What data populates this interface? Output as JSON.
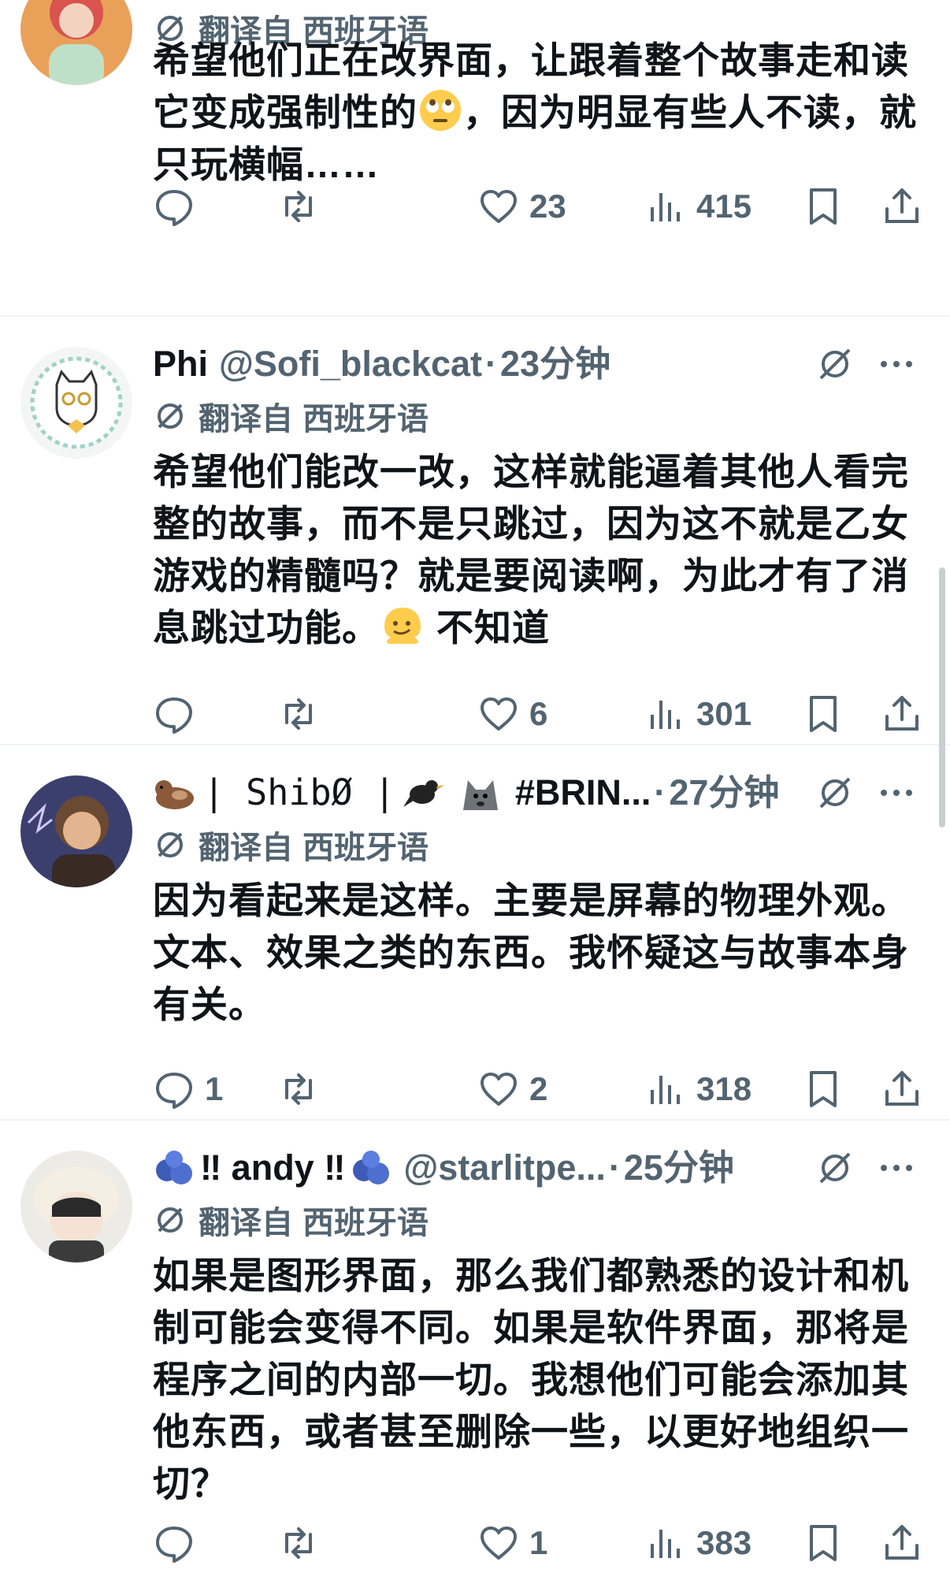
{
  "colors": {
    "text_primary": "#0f1419",
    "text_secondary": "#536471",
    "divider": "#eff3f4"
  },
  "icons": {
    "reply": "reply-icon",
    "retweet": "retweet-icon",
    "like": "heart-icon",
    "views": "views-icon",
    "bookmark": "bookmark-icon",
    "share": "share-icon",
    "translate": "translate-icon",
    "grok": "grok-icon",
    "more": "more-icon"
  },
  "tweets": [
    {
      "translated_label": "翻译自",
      "translated_lang": "西班牙语",
      "text": "希望他们正在改界面，让跟着整个故事走和读它变成强制性的🙄，因为明显有些人不读，就只玩横幅……",
      "text_before_emoji": "希望他们正在改界面，让跟着整个故事走和读它变成强制性的",
      "text_after_emoji": "，因为明显有些人不读，就只玩横幅……",
      "replies": "",
      "retweets": "",
      "likes": "23",
      "views": "415"
    },
    {
      "display_name": "Phi",
      "handle": "@Sofi_blackcat",
      "dot": "·",
      "time": "23分钟",
      "translated_label": "翻译自",
      "translated_lang": "西班牙语",
      "text_before_emoji": "希望他们能改一改，这样就能逼着其他人看完整的故事，而不是只跳过，因为这不就是乙女游戏的精髓吗？就是要阅读啊，为此才有了消息跳过功能。",
      "text_after_emoji": " 不知道",
      "replies": "",
      "retweets": "",
      "likes": "6",
      "views": "301"
    },
    {
      "display_name_text": "| ShibØ |",
      "display_name_tag": "#BRIN...",
      "dot": "·",
      "time": "27分钟",
      "translated_label": "翻译自",
      "translated_lang": "西班牙语",
      "text": "因为看起来是这样。主要是屏幕的物理外观。文本、效果之类的东西。我怀疑这与故事本身有关。",
      "replies": "1",
      "retweets": "",
      "likes": "2",
      "views": "318"
    },
    {
      "display_name": "‼ andy ‼",
      "handle": "@starlitpe...",
      "dot": "·",
      "time": "25分钟",
      "translated_label": "翻译自",
      "translated_lang": "西班牙语",
      "text": "如果是图形界面，那么我们都熟悉的设计和机制可能会变得不同。如果是软件界面，那将是程序之间的内部一切。我想他们可能会添加其他东西，或者甚至删除一些，以更好地组织一切？",
      "replies": "",
      "retweets": "",
      "likes": "1",
      "views": "383"
    }
  ]
}
